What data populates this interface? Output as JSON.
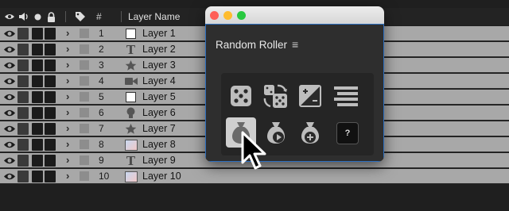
{
  "timeline": {
    "header": {
      "hash_label": "#",
      "layer_name_label": "Layer Name",
      "icons": [
        "eye-icon",
        "speaker-icon",
        "solo-dot-icon",
        "lock-icon",
        "label-tag-icon"
      ]
    },
    "layers": [
      {
        "num": "1",
        "name": "Layer 1",
        "type": "solid"
      },
      {
        "num": "2",
        "name": "Layer 2",
        "type": "text"
      },
      {
        "num": "3",
        "name": "Layer 3",
        "type": "shape"
      },
      {
        "num": "4",
        "name": "Layer 4",
        "type": "camera"
      },
      {
        "num": "5",
        "name": "Layer 5",
        "type": "solid"
      },
      {
        "num": "6",
        "name": "Layer 6",
        "type": "light"
      },
      {
        "num": "7",
        "name": "Layer 7",
        "type": "shape"
      },
      {
        "num": "8",
        "name": "Layer 8",
        "type": "image"
      },
      {
        "num": "9",
        "name": "Layer 9",
        "type": "text"
      },
      {
        "num": "10",
        "name": "Layer 10",
        "type": "image"
      }
    ]
  },
  "window": {
    "title": "Random Roller",
    "menu_icon": "hamburger-menu-icon",
    "traffic_lights": {
      "close": "#fe5f57",
      "minimize": "#febc2e",
      "zoom": "#28c840"
    },
    "buttons": [
      {
        "icon": "die-icon",
        "selected": false
      },
      {
        "icon": "shuffle-dice-icon",
        "selected": false
      },
      {
        "icon": "gradient-square-icon",
        "selected": false
      },
      {
        "icon": "stacked-bars-icon",
        "selected": false
      },
      {
        "icon": "money-bag-icon",
        "selected": true
      },
      {
        "icon": "money-bag-play-icon",
        "selected": false
      },
      {
        "icon": "money-bag-plus-icon",
        "selected": false
      },
      {
        "icon": "help-icon",
        "label": "?",
        "selected": false
      }
    ],
    "accent": "#2d6fbf"
  }
}
